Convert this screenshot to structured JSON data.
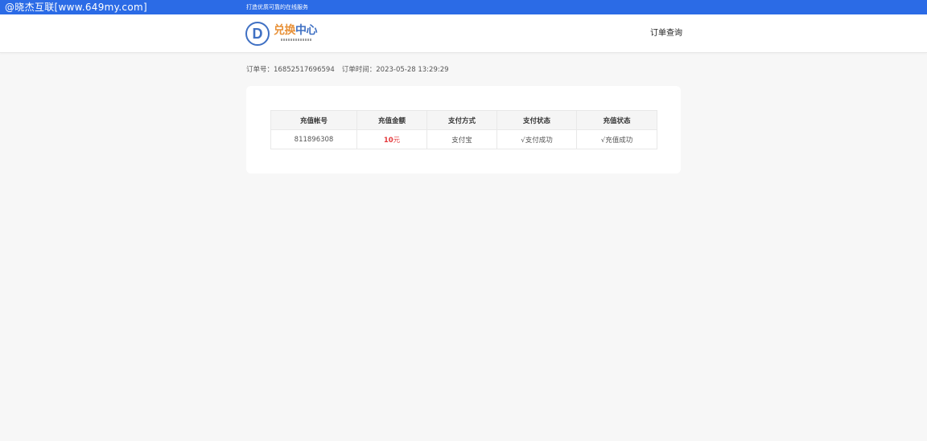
{
  "topbar": {
    "watermark": "@晓杰互联[www.649my.com]",
    "slogan": "打造优质可靠的在线服务"
  },
  "header": {
    "logo_letter": "D",
    "logo_text_part1": "兑换",
    "logo_text_part2": "中心",
    "nav_query_label": "订单查询"
  },
  "order_meta": {
    "order_no_label": "订单号：",
    "order_no": "16852517696594",
    "order_time_label": "订单时间：",
    "order_time": "2023-05-28 13:29:29"
  },
  "table": {
    "headers": [
      "充值帐号",
      "充值金额",
      "支付方式",
      "支付状态",
      "充值状态"
    ],
    "rows": [
      {
        "account": "811896308",
        "amount": "10",
        "amount_unit": "元",
        "payment_method": "支付宝",
        "payment_status": "√支付成功",
        "recharge_status": "√充值成功"
      }
    ]
  },
  "colors": {
    "topbar": "#2b6be6",
    "logo_orange": "#e8923a",
    "logo_blue": "#3f70c3",
    "amount_red": "#e4393c",
    "success_green": "#1aa51a"
  }
}
